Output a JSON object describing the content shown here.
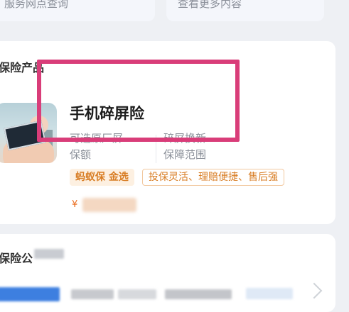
{
  "top_buttons": {
    "left_label": "服务网点查询",
    "right_label": "查看更多内容"
  },
  "section": {
    "title": "保险产品"
  },
  "product": {
    "title": "手机碎屏险",
    "feature1_value": "可选原厂屏",
    "feature1_label": "保额",
    "feature2_value": "碎屏换新",
    "feature2_label": "保障范围",
    "badge_brand": "蚂蚁保 金选",
    "badge_tags": "投保灵活、理赔便捷、售后强",
    "price_symbol": "¥"
  },
  "section2": {
    "title": "保险公"
  },
  "colors": {
    "highlight": "#d93d79",
    "accent_orange": "#d87d24"
  }
}
